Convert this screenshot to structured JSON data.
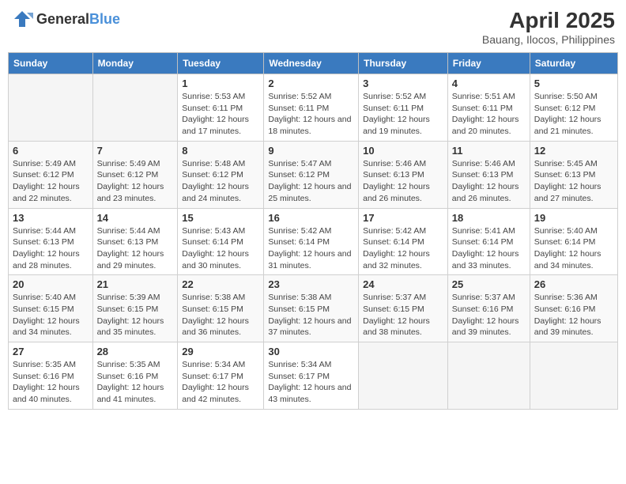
{
  "header": {
    "logo_general": "General",
    "logo_blue": "Blue",
    "title": "April 2025",
    "subtitle": "Bauang, Ilocos, Philippines"
  },
  "days_of_week": [
    "Sunday",
    "Monday",
    "Tuesday",
    "Wednesday",
    "Thursday",
    "Friday",
    "Saturday"
  ],
  "weeks": [
    [
      {
        "day": "",
        "sunrise": "",
        "sunset": "",
        "daylight": ""
      },
      {
        "day": "",
        "sunrise": "",
        "sunset": "",
        "daylight": ""
      },
      {
        "day": "1",
        "sunrise": "Sunrise: 5:53 AM",
        "sunset": "Sunset: 6:11 PM",
        "daylight": "Daylight: 12 hours and 17 minutes."
      },
      {
        "day": "2",
        "sunrise": "Sunrise: 5:52 AM",
        "sunset": "Sunset: 6:11 PM",
        "daylight": "Daylight: 12 hours and 18 minutes."
      },
      {
        "day": "3",
        "sunrise": "Sunrise: 5:52 AM",
        "sunset": "Sunset: 6:11 PM",
        "daylight": "Daylight: 12 hours and 19 minutes."
      },
      {
        "day": "4",
        "sunrise": "Sunrise: 5:51 AM",
        "sunset": "Sunset: 6:11 PM",
        "daylight": "Daylight: 12 hours and 20 minutes."
      },
      {
        "day": "5",
        "sunrise": "Sunrise: 5:50 AM",
        "sunset": "Sunset: 6:12 PM",
        "daylight": "Daylight: 12 hours and 21 minutes."
      }
    ],
    [
      {
        "day": "6",
        "sunrise": "Sunrise: 5:49 AM",
        "sunset": "Sunset: 6:12 PM",
        "daylight": "Daylight: 12 hours and 22 minutes."
      },
      {
        "day": "7",
        "sunrise": "Sunrise: 5:49 AM",
        "sunset": "Sunset: 6:12 PM",
        "daylight": "Daylight: 12 hours and 23 minutes."
      },
      {
        "day": "8",
        "sunrise": "Sunrise: 5:48 AM",
        "sunset": "Sunset: 6:12 PM",
        "daylight": "Daylight: 12 hours and 24 minutes."
      },
      {
        "day": "9",
        "sunrise": "Sunrise: 5:47 AM",
        "sunset": "Sunset: 6:12 PM",
        "daylight": "Daylight: 12 hours and 25 minutes."
      },
      {
        "day": "10",
        "sunrise": "Sunrise: 5:46 AM",
        "sunset": "Sunset: 6:13 PM",
        "daylight": "Daylight: 12 hours and 26 minutes."
      },
      {
        "day": "11",
        "sunrise": "Sunrise: 5:46 AM",
        "sunset": "Sunset: 6:13 PM",
        "daylight": "Daylight: 12 hours and 26 minutes."
      },
      {
        "day": "12",
        "sunrise": "Sunrise: 5:45 AM",
        "sunset": "Sunset: 6:13 PM",
        "daylight": "Daylight: 12 hours and 27 minutes."
      }
    ],
    [
      {
        "day": "13",
        "sunrise": "Sunrise: 5:44 AM",
        "sunset": "Sunset: 6:13 PM",
        "daylight": "Daylight: 12 hours and 28 minutes."
      },
      {
        "day": "14",
        "sunrise": "Sunrise: 5:44 AM",
        "sunset": "Sunset: 6:13 PM",
        "daylight": "Daylight: 12 hours and 29 minutes."
      },
      {
        "day": "15",
        "sunrise": "Sunrise: 5:43 AM",
        "sunset": "Sunset: 6:14 PM",
        "daylight": "Daylight: 12 hours and 30 minutes."
      },
      {
        "day": "16",
        "sunrise": "Sunrise: 5:42 AM",
        "sunset": "Sunset: 6:14 PM",
        "daylight": "Daylight: 12 hours and 31 minutes."
      },
      {
        "day": "17",
        "sunrise": "Sunrise: 5:42 AM",
        "sunset": "Sunset: 6:14 PM",
        "daylight": "Daylight: 12 hours and 32 minutes."
      },
      {
        "day": "18",
        "sunrise": "Sunrise: 5:41 AM",
        "sunset": "Sunset: 6:14 PM",
        "daylight": "Daylight: 12 hours and 33 minutes."
      },
      {
        "day": "19",
        "sunrise": "Sunrise: 5:40 AM",
        "sunset": "Sunset: 6:14 PM",
        "daylight": "Daylight: 12 hours and 34 minutes."
      }
    ],
    [
      {
        "day": "20",
        "sunrise": "Sunrise: 5:40 AM",
        "sunset": "Sunset: 6:15 PM",
        "daylight": "Daylight: 12 hours and 34 minutes."
      },
      {
        "day": "21",
        "sunrise": "Sunrise: 5:39 AM",
        "sunset": "Sunset: 6:15 PM",
        "daylight": "Daylight: 12 hours and 35 minutes."
      },
      {
        "day": "22",
        "sunrise": "Sunrise: 5:38 AM",
        "sunset": "Sunset: 6:15 PM",
        "daylight": "Daylight: 12 hours and 36 minutes."
      },
      {
        "day": "23",
        "sunrise": "Sunrise: 5:38 AM",
        "sunset": "Sunset: 6:15 PM",
        "daylight": "Daylight: 12 hours and 37 minutes."
      },
      {
        "day": "24",
        "sunrise": "Sunrise: 5:37 AM",
        "sunset": "Sunset: 6:15 PM",
        "daylight": "Daylight: 12 hours and 38 minutes."
      },
      {
        "day": "25",
        "sunrise": "Sunrise: 5:37 AM",
        "sunset": "Sunset: 6:16 PM",
        "daylight": "Daylight: 12 hours and 39 minutes."
      },
      {
        "day": "26",
        "sunrise": "Sunrise: 5:36 AM",
        "sunset": "Sunset: 6:16 PM",
        "daylight": "Daylight: 12 hours and 39 minutes."
      }
    ],
    [
      {
        "day": "27",
        "sunrise": "Sunrise: 5:35 AM",
        "sunset": "Sunset: 6:16 PM",
        "daylight": "Daylight: 12 hours and 40 minutes."
      },
      {
        "day": "28",
        "sunrise": "Sunrise: 5:35 AM",
        "sunset": "Sunset: 6:16 PM",
        "daylight": "Daylight: 12 hours and 41 minutes."
      },
      {
        "day": "29",
        "sunrise": "Sunrise: 5:34 AM",
        "sunset": "Sunset: 6:17 PM",
        "daylight": "Daylight: 12 hours and 42 minutes."
      },
      {
        "day": "30",
        "sunrise": "Sunrise: 5:34 AM",
        "sunset": "Sunset: 6:17 PM",
        "daylight": "Daylight: 12 hours and 43 minutes."
      },
      {
        "day": "",
        "sunrise": "",
        "sunset": "",
        "daylight": ""
      },
      {
        "day": "",
        "sunrise": "",
        "sunset": "",
        "daylight": ""
      },
      {
        "day": "",
        "sunrise": "",
        "sunset": "",
        "daylight": ""
      }
    ]
  ]
}
